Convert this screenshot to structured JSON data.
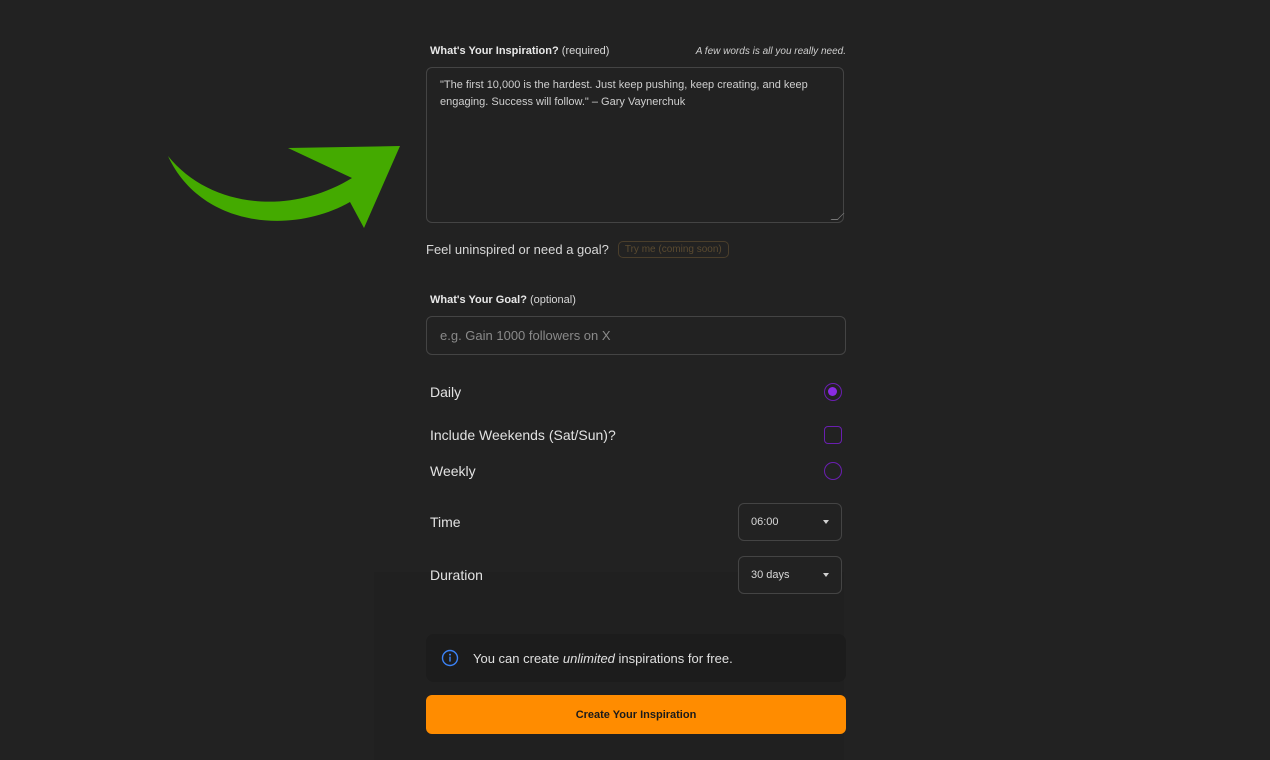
{
  "inspiration": {
    "label": "What's Your Inspiration?",
    "required_note": "(required)",
    "hint": "A few words is all you really need.",
    "value": "\"The first 10,000 is the hardest. Just keep pushing, keep creating, and keep engaging. Success will follow.\" – Gary Vaynerchuk"
  },
  "feel": {
    "text": "Feel uninspired or need a goal?",
    "button": "Try me (coming soon)"
  },
  "goal": {
    "label": "What's Your Goal?",
    "optional_note": "(optional)",
    "placeholder": "e.g. Gain 1000 followers on X"
  },
  "schedule": {
    "daily": "Daily",
    "include_weekends": "Include Weekends (Sat/Sun)?",
    "weekly": "Weekly",
    "selected": "Daily"
  },
  "time": {
    "label": "Time",
    "value": "06:00"
  },
  "duration": {
    "label": "Duration",
    "value": "30 days"
  },
  "info": {
    "prefix": "You can create ",
    "emphasis": "unlimited",
    "suffix": " inspirations for free."
  },
  "cta": {
    "label": "Create Your Inspiration"
  },
  "colors": {
    "background": "#222222",
    "accent_purple": "#8a2be2",
    "cta_orange": "#ff8c00",
    "arrow_green": "#44aa00",
    "info_blue": "#3b82f6"
  },
  "icons": {
    "arrow": "green-arrow-icon",
    "info": "info-circle-icon",
    "caret": "caret-down-icon"
  }
}
